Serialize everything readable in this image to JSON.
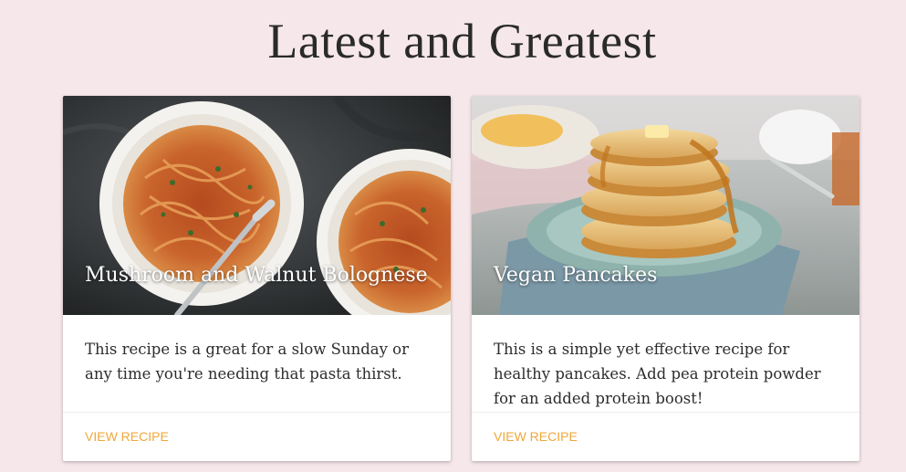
{
  "page": {
    "title": "Latest and Greatest"
  },
  "cards": [
    {
      "title": "Mushroom and Walnut Bolognese",
      "description": "This recipe is a great for a slow Sunday or any time you're needing that pasta thirst.",
      "action_label": "VIEW RECIPE",
      "image_icon": "pasta-image"
    },
    {
      "title": "Vegan Pancakes",
      "description": "This is a simple yet effective recipe for healthy pancakes. Add pea protein powder for an added protein boost!",
      "action_label": "VIEW RECIPE",
      "image_icon": "pancakes-image"
    }
  ],
  "colors": {
    "background": "#f6e8ea",
    "accent": "#f0a73a",
    "card": "#ffffff"
  }
}
